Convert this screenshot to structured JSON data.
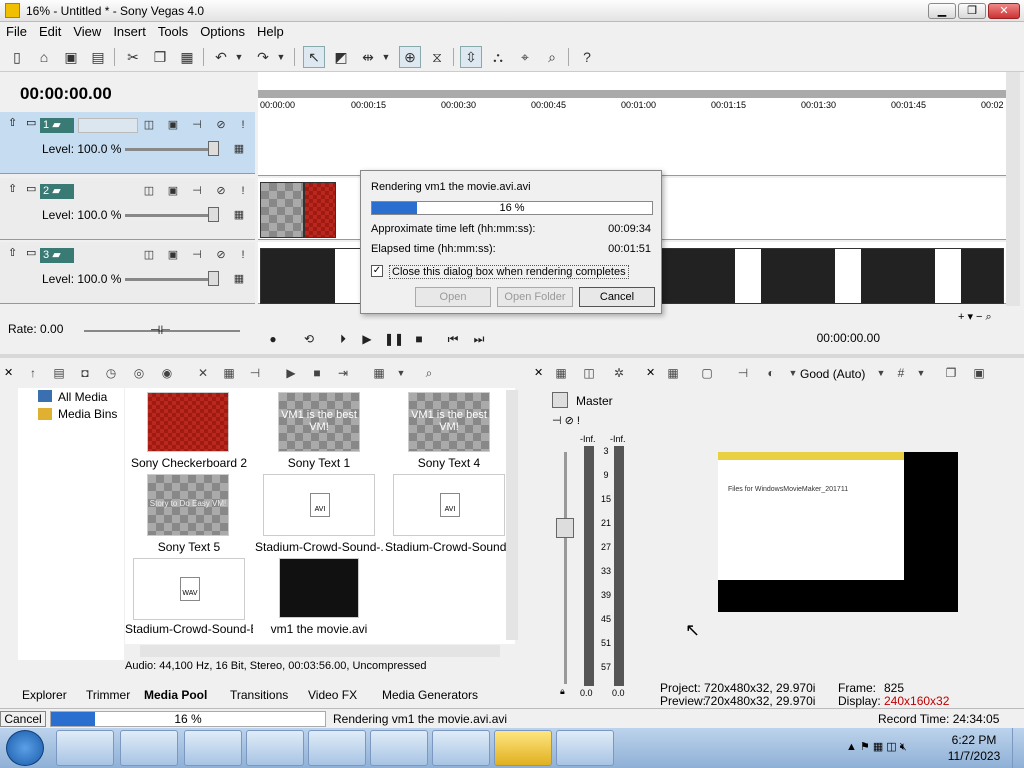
{
  "window": {
    "title": "16% - Untitled * - Sony Vegas 4.0",
    "minimize": "▁",
    "maximize": "❐",
    "close": "✕"
  },
  "menu": [
    "File",
    "Edit",
    "View",
    "Insert",
    "Tools",
    "Options",
    "Help"
  ],
  "timeline": {
    "timecode": "00:00:00.00",
    "ticks": [
      "00:00:00",
      "00:00:15",
      "00:00:30",
      "00:00:45",
      "00:01:00",
      "00:01:15",
      "00:01:30",
      "00:01:45",
      "00:02"
    ],
    "tracks": [
      {
        "number": "1",
        "level": "Level: 100.0 %"
      },
      {
        "number": "2",
        "level": "Level: 100.0 %"
      },
      {
        "number": "3",
        "level": "Level: 100.0 %"
      }
    ],
    "rate": "Rate: 0.00",
    "position": "00:00:00.00"
  },
  "dialog": {
    "title": "Rendering vm1 the movie.avi.avi",
    "progress_label": "16 %",
    "progress": 0.16,
    "time_left_label": "Approximate time left (hh:mm:ss):",
    "time_left": "00:09:34",
    "elapsed_label": "Elapsed time (hh:mm:ss):",
    "elapsed": "00:01:51",
    "close_checkbox": "Close this dialog box when rendering completes",
    "close_checked": "✓",
    "open": "Open",
    "open_folder": "Open Folder",
    "cancel": "Cancel"
  },
  "media": {
    "tree": [
      "All Media",
      "Media Bins"
    ],
    "items": [
      {
        "label": "Sony Checkerboard 2"
      },
      {
        "label": "Sony Text 1",
        "overlay": "VM1 is the best VM!"
      },
      {
        "label": "Sony Text 4",
        "overlay": "VM1 is the best VM!"
      },
      {
        "label": "Sony Text 5",
        "overlay": "Story to Do Easy VM!"
      },
      {
        "label": "Stadium-Crowd-Sound-...",
        "badge": "AVI"
      },
      {
        "label": "Stadium-Crowd-Sound-...",
        "badge": "AVI"
      },
      {
        "label": "Stadium-Crowd-Sound-E...",
        "badge": "WAV"
      },
      {
        "label": "vm1 the movie.avi"
      }
    ],
    "info": "Audio: 44,100 Hz, 16 Bit, Stereo, 00:03:56.00, Uncompressed",
    "tabs": [
      "Explorer",
      "Trimmer",
      "Media Pool",
      "Transitions",
      "Video FX",
      "Media Generators"
    ]
  },
  "mixer": {
    "master": "Master",
    "inf_left": "-Inf.",
    "inf_right": "-Inf.",
    "scale": [
      "3",
      "9",
      "15",
      "21",
      "27",
      "33",
      "39",
      "45",
      "51",
      "57"
    ],
    "bottom_left": "0.0",
    "bottom_right": "0.0"
  },
  "preview": {
    "quality": "Good (Auto)",
    "project_label": "Project:",
    "project": "720x480x32, 29.970i",
    "preview_label": "Preview:",
    "preview_val": "720x480x32, 29.970i",
    "frame_label": "Frame:",
    "frame": "825",
    "display_label": "Display:",
    "display": "240x160x32",
    "screen_title": "Files for WindowsMovieMaker_201711"
  },
  "status": {
    "cancel": "Cancel",
    "progress_label": "16 %",
    "message": "Rendering vm1 the movie.avi.avi",
    "record_time": "Record Time: 24:34:05"
  },
  "taskbar": {
    "time": "6:22 PM",
    "date": "11/7/2023"
  },
  "colors": {
    "accent": "#2a6fd0",
    "track_selected": "#c6dcf0",
    "display_red": "#c00000"
  }
}
